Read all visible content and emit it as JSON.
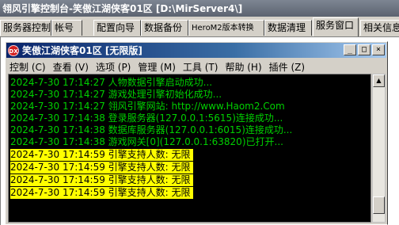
{
  "outer_window": {
    "title": "翎风引擎控制台-笑傲江湖侠客01区 [D:\\MirServer4\\]"
  },
  "tabs": [
    {
      "label": "服务器控制"
    },
    {
      "label": "帐号"
    },
    {
      "label": "配置向导"
    },
    {
      "label": "数据备份"
    },
    {
      "label": "HeroM2版本转换"
    },
    {
      "label": "数据清理"
    },
    {
      "label": "服务窗口"
    },
    {
      "label": "相关信息"
    }
  ],
  "active_tab": "服务窗口",
  "inner_window": {
    "icon": "DX",
    "title": "笑傲江湖侠客01区 [无限版]",
    "controls": {
      "minimize": "_",
      "maximize": "□",
      "close": "×"
    }
  },
  "menu": [
    {
      "label": "控制 (C)"
    },
    {
      "label": "查看 (V)"
    },
    {
      "label": "选项 (P)"
    },
    {
      "label": "管理 (M)"
    },
    {
      "label": "工具 (T)"
    },
    {
      "label": "帮助 (H)"
    },
    {
      "label": "插件 (Z)"
    }
  ],
  "log": [
    {
      "date": "2024-7-30",
      "time": "17:14:27",
      "message": "人物数据引擎启动成功..."
    },
    {
      "date": "2024-7-30",
      "time": "17:14:27",
      "message": "游戏处理引擎初始化成功..."
    },
    {
      "date": "2024-7-30",
      "time": "17:14:27",
      "message": "翎风引擎网站: http://www.Haom2.Com"
    },
    {
      "date": "2024-7-30",
      "time": "17:14:38",
      "message": "登录服务器(127.0.0.1:5615)连接成功..."
    },
    {
      "date": "2024-7-30",
      "time": "17:14:38",
      "message": "数据库服务器(127.0.0.1:6015)连接成功..."
    },
    {
      "date": "2024-7-30",
      "time": "17:14:38",
      "message": "游戏网关[0](127.0.0.1:63820)已打开..."
    },
    {
      "date": "2024-7-30",
      "time": "17:14:59",
      "message": "引擎支持人数: 无限"
    },
    {
      "date": "2024-7-30",
      "time": "17:14:59",
      "message": "引擎支持人数: 无限"
    },
    {
      "date": "2024-7-30",
      "time": "17:14:59",
      "message": "引擎支持人数: 无限"
    },
    {
      "date": "2024-7-30",
      "time": "17:14:59",
      "message": "引擎支持人数: 无限"
    }
  ],
  "colors": {
    "log_text": "#00d000",
    "log_highlight_bg": "#ffff00",
    "log_background": "#000000",
    "inner_title_bg": "#0a246a"
  }
}
